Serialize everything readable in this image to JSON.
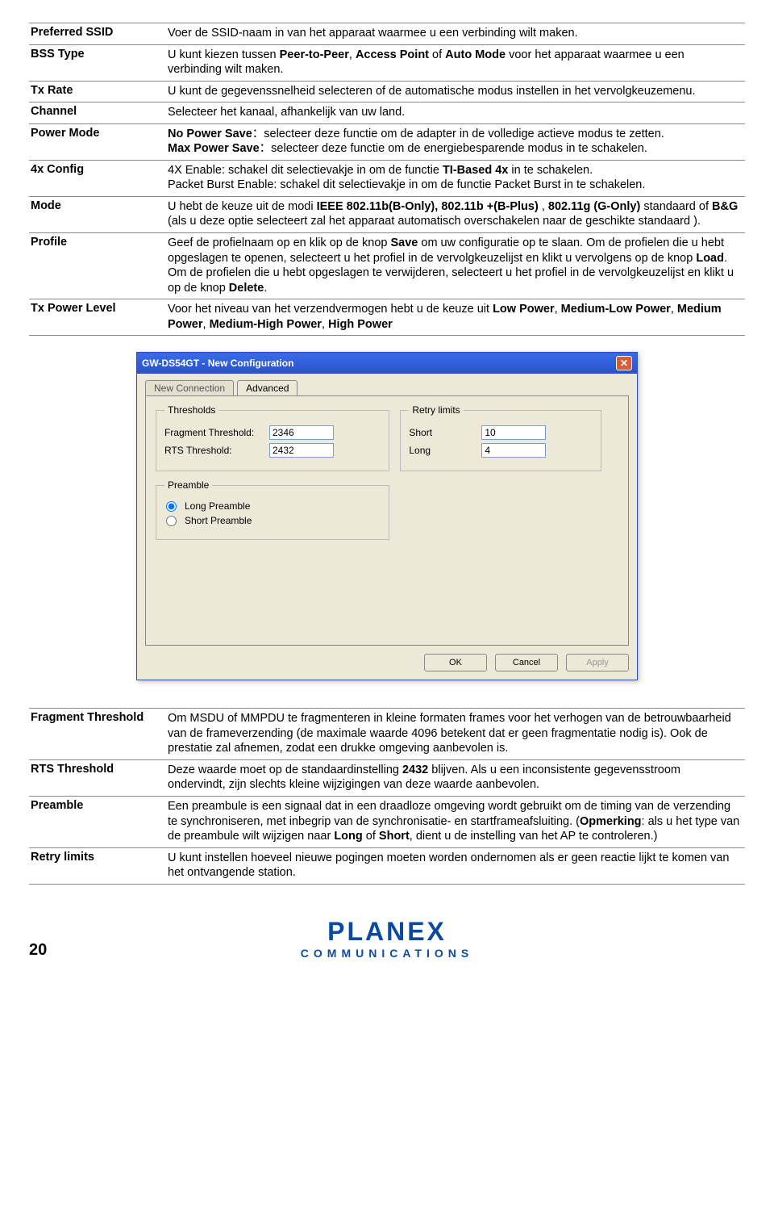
{
  "table1": [
    {
      "k": "Preferred SSID",
      "v": "Voer de SSID-naam in van het apparaat waarmee u een verbinding wilt maken."
    },
    {
      "k": "BSS Type",
      "v": "U kunt kiezen tussen <b>Peer-to-Peer</b>, <b>Access Point</b> of <b>Auto Mode</b> voor het apparaat waarmee u een verbinding wilt maken."
    },
    {
      "k": "Tx Rate",
      "v": "U kunt de gegevenssnelheid selecteren of de automatische modus instellen in het vervolgkeuzemenu."
    },
    {
      "k": "Channel",
      "v": "Selecteer het kanaal, afhankelijk van uw land."
    },
    {
      "k": "Power Mode",
      "v": "<b>No Power Save</b>：selecteer deze functie om de adapter in de volledige actieve modus te zetten.<br><b>Max Power Save</b>：selecteer deze functie om de energiebesparende modus in te schakelen."
    },
    {
      "k": "4x Config",
      "v": "4X Enable: schakel dit selectievakje in om de functie <b>TI-Based 4x</b> in te schakelen.<br>Packet Burst Enable: schakel dit selectievakje in om de functie Packet Burst in te schakelen."
    },
    {
      "k": "Mode",
      "v": "U hebt de keuze uit de modi <b>IEEE 802.11b(B-Only), 802.11b +(B-Plus)</b> , <b>802.11g (G-Only)</b> standaard of <b>B&G</b> (als u deze optie selecteert zal het apparaat automatisch overschakelen naar de geschikte standaard )."
    },
    {
      "k": "Profile",
      "v": "Geef de profielnaam op en klik op de knop <b>Save</b> om uw configuratie op te slaan. Om de profielen die u hebt opgeslagen te openen, selecteert u het profiel in de vervolgkeuzelijst en klikt u vervolgens op de knop <b>Load</b>. Om de profielen die u hebt opgeslagen te verwijderen, selecteert u het profiel in de vervolgkeuzelijst  en klikt u op de knop <b>Delete</b>."
    },
    {
      "k": "Tx Power Level",
      "v": "Voor het niveau van het verzendvermogen hebt u de keuze uit <b>Low Power</b>, <b>Medium-Low Power</b>, <b>Medium Power</b>, <b>Medium-High Power</b>, <b>High Power</b>"
    }
  ],
  "win": {
    "title": "GW-DS54GT - New Configuration",
    "tabs": {
      "inactive": "New Connection",
      "active": "Advanced"
    },
    "thresholds": {
      "legend": "Thresholds",
      "frag_label": "Fragment Threshold:",
      "frag_value": "2346",
      "rts_label": "RTS Threshold:",
      "rts_value": "2432"
    },
    "retry": {
      "legend": "Retry limits",
      "short_label": "Short",
      "short_value": "10",
      "long_label": "Long",
      "long_value": "4"
    },
    "preamble": {
      "legend": "Preamble",
      "long": "Long Preamble",
      "short": "Short Preamble"
    },
    "buttons": {
      "ok": "OK",
      "cancel": "Cancel",
      "apply": "Apply"
    }
  },
  "table2": [
    {
      "k": "Fragment Threshold",
      "v": "Om MSDU of MMPDU te fragmenteren in kleine formaten frames voor het verhogen van de betrouwbaarheid van de frameverzending (de maximale waarde 4096 betekent dat er geen fragmentatie nodig is). Ook de prestatie zal afnemen, zodat een drukke omgeving aanbevolen is."
    },
    {
      "k": "RTS Threshold",
      "v": "Deze waarde moet op de standaardinstelling <b>2432</b> blijven. Als u een inconsistente gegevensstroom ondervindt, zijn slechts kleine wijzigingen van deze waarde aanbevolen."
    },
    {
      "k": "Preamble",
      "v": "Een preambule is een signaal dat in een draadloze omgeving wordt gebruikt om de timing van de verzending te synchroniseren, met inbegrip van de synchronisatie- en startframeafsluiting. (<b>Opmerking</b>: als u het type van de preambule wilt wijzigen naar <b>Long</b> of <b>Short</b>, dient u de instelling van het AP te controleren.)"
    },
    {
      "k": "Retry limits",
      "v": "U kunt instellen hoeveel nieuwe pogingen moeten worden ondernomen als er geen reactie lijkt te komen van het ontvangende station."
    }
  ],
  "footer": {
    "page": "20",
    "logo_top": "PLANEX",
    "logo_sub": "COMMUNICATIONS"
  }
}
